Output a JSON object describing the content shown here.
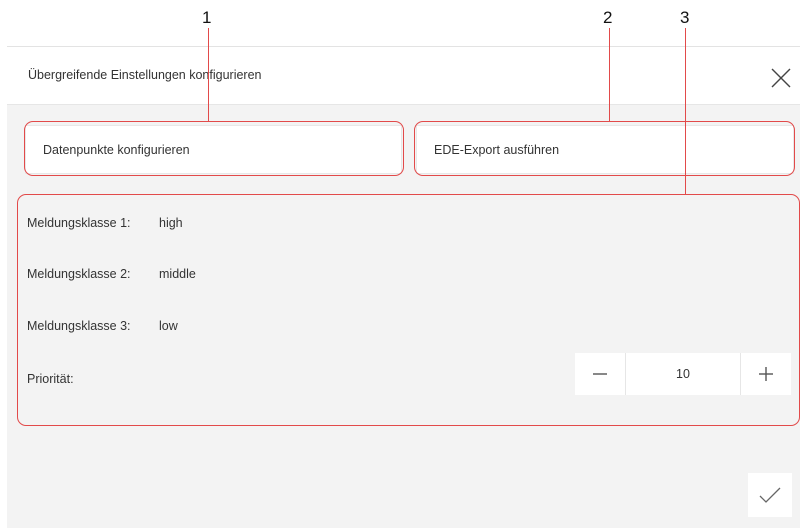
{
  "callouts": [
    "1",
    "2",
    "3"
  ],
  "dialog": {
    "title": "Übergreifende Einstellungen konfigurieren",
    "close_icon": "close-icon",
    "confirm_icon": "checkmark-icon"
  },
  "actions": {
    "datapoints_label": "Datenpunkte konfigurieren",
    "ede_export_label": "EDE-Export ausführen"
  },
  "settings": {
    "rows": [
      {
        "label": "Meldungsklasse 1:",
        "value": "high"
      },
      {
        "label": "Meldungsklasse 2:",
        "value": "middle"
      },
      {
        "label": "Meldungsklasse 3:",
        "value": "low"
      }
    ],
    "priority": {
      "label": "Priorität:",
      "value": "10",
      "decrement_icon": "minus-icon",
      "increment_icon": "plus-icon"
    }
  },
  "colors": {
    "callout_outline": "#e24a4a",
    "dialog_background": "#f3f3f3",
    "panel_background": "#ffffff"
  }
}
